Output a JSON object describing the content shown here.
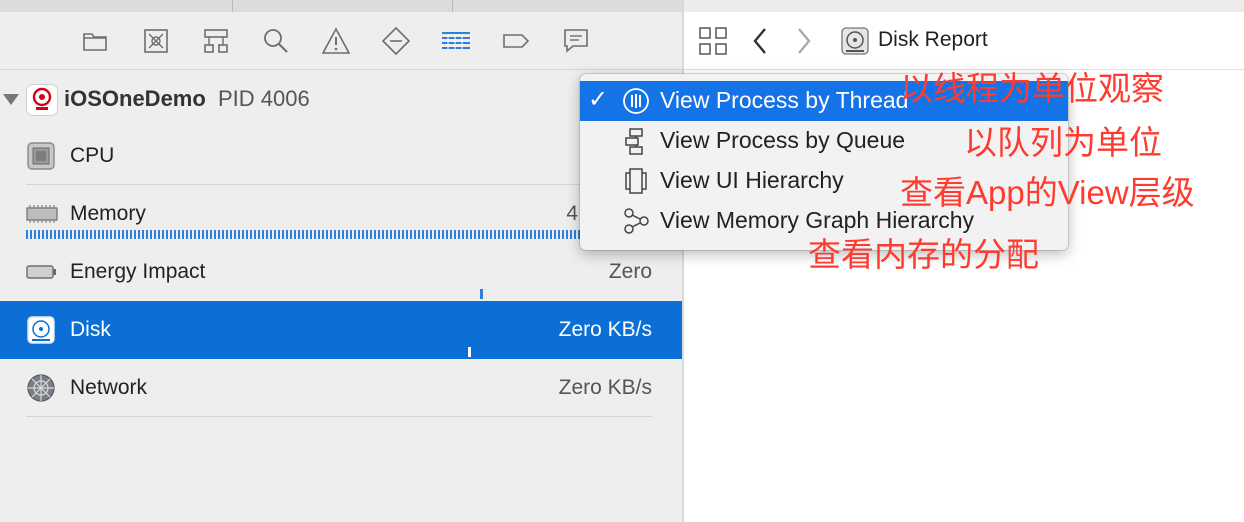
{
  "toolbar": {
    "icons": [
      "folder-icon",
      "warning-box-icon",
      "hierarchy-icon",
      "search-icon",
      "triangle-warning-icon",
      "breakpoint-diamond-icon",
      "debug-navigator-icon",
      "tag-icon",
      "chat-icon"
    ],
    "active_icon": "debug-navigator-icon",
    "accent_color": "#2c7fdc"
  },
  "process": {
    "name": "iOSOneDemo",
    "pid": "PID 4006"
  },
  "gauges": [
    {
      "label": "CPU",
      "value": "",
      "icon": "cpu-icon"
    },
    {
      "label": "Memory",
      "value": "4",
      "icon": "memory-icon"
    },
    {
      "label": "Energy Impact",
      "value": "Zero",
      "icon": "battery-icon"
    },
    {
      "label": "Disk",
      "value": "Zero KB/s",
      "icon": "disk-icon",
      "selected": true
    },
    {
      "label": "Network",
      "value": "Zero KB/s",
      "icon": "network-icon"
    }
  ],
  "right_header": {
    "title": "Disk Report"
  },
  "menu": {
    "items": [
      {
        "label": "View Process by Thread",
        "checked": true,
        "icon": "thread-icon"
      },
      {
        "label": "View Process by Queue",
        "checked": false,
        "icon": "queue-icon"
      },
      {
        "label": "View UI Hierarchy",
        "checked": false,
        "icon": "ui-hierarchy-icon"
      },
      {
        "label": "View Memory Graph Hierarchy",
        "checked": false,
        "icon": "memory-graph-icon"
      }
    ],
    "check_mark": "✓",
    "selection_color": "#1473e6"
  },
  "annotations": [
    "以线程为单位观察",
    "以队列为单位",
    "查看App的View层级",
    "查看内存的分配"
  ],
  "selection_color": "#0b6fd6",
  "annotation_color": "#ff3b2f"
}
